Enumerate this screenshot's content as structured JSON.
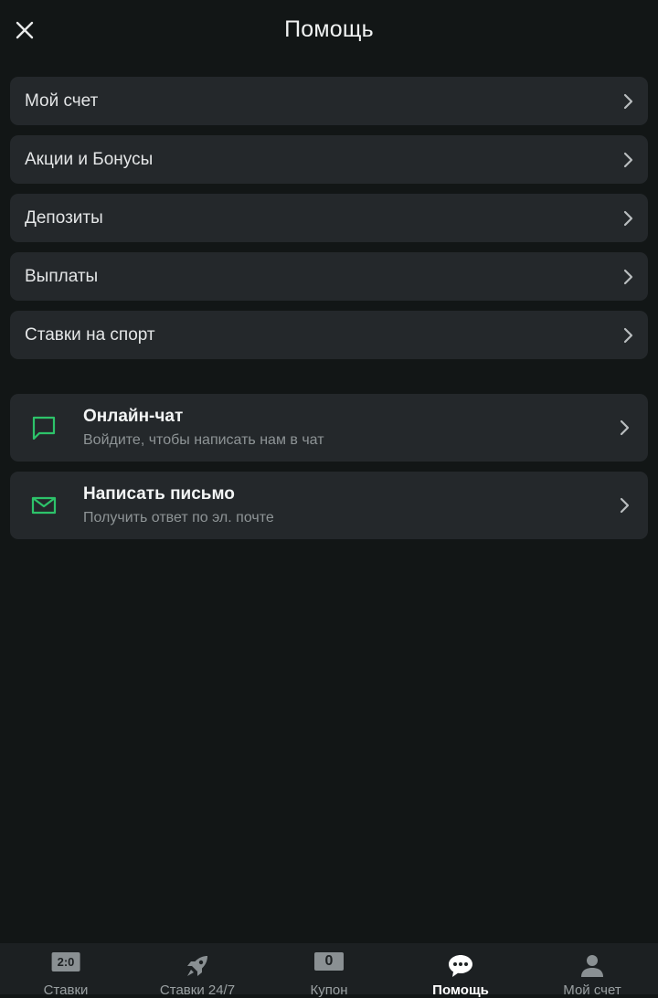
{
  "header": {
    "title": "Помощь"
  },
  "help_topics": [
    {
      "label": "Мой счет"
    },
    {
      "label": "Акции и Бонусы"
    },
    {
      "label": "Депозиты"
    },
    {
      "label": "Выплаты"
    },
    {
      "label": "Ставки на спорт"
    }
  ],
  "contacts": [
    {
      "title": "Онлайн-чат",
      "subtitle": "Войдите, чтобы написать нам в чат",
      "icon": "chat-icon"
    },
    {
      "title": "Написать письмо",
      "subtitle": "Получить ответ по эл. почте",
      "icon": "mail-icon"
    }
  ],
  "bottom_nav": [
    {
      "label": "Ставки",
      "icon": "score-icon",
      "badge": "2:0"
    },
    {
      "label": "Ставки 24/7",
      "icon": "rocket-icon"
    },
    {
      "label": "Купон",
      "icon": "coupon-icon",
      "badge": "0"
    },
    {
      "label": "Помощь",
      "icon": "chat-bubble-icon",
      "active": true
    },
    {
      "label": "Мой счет",
      "icon": "user-icon"
    }
  ],
  "colors": {
    "background": "#121616",
    "card": "#24282b",
    "accent_green": "#2dc36a",
    "nav_background": "#1c2022"
  }
}
